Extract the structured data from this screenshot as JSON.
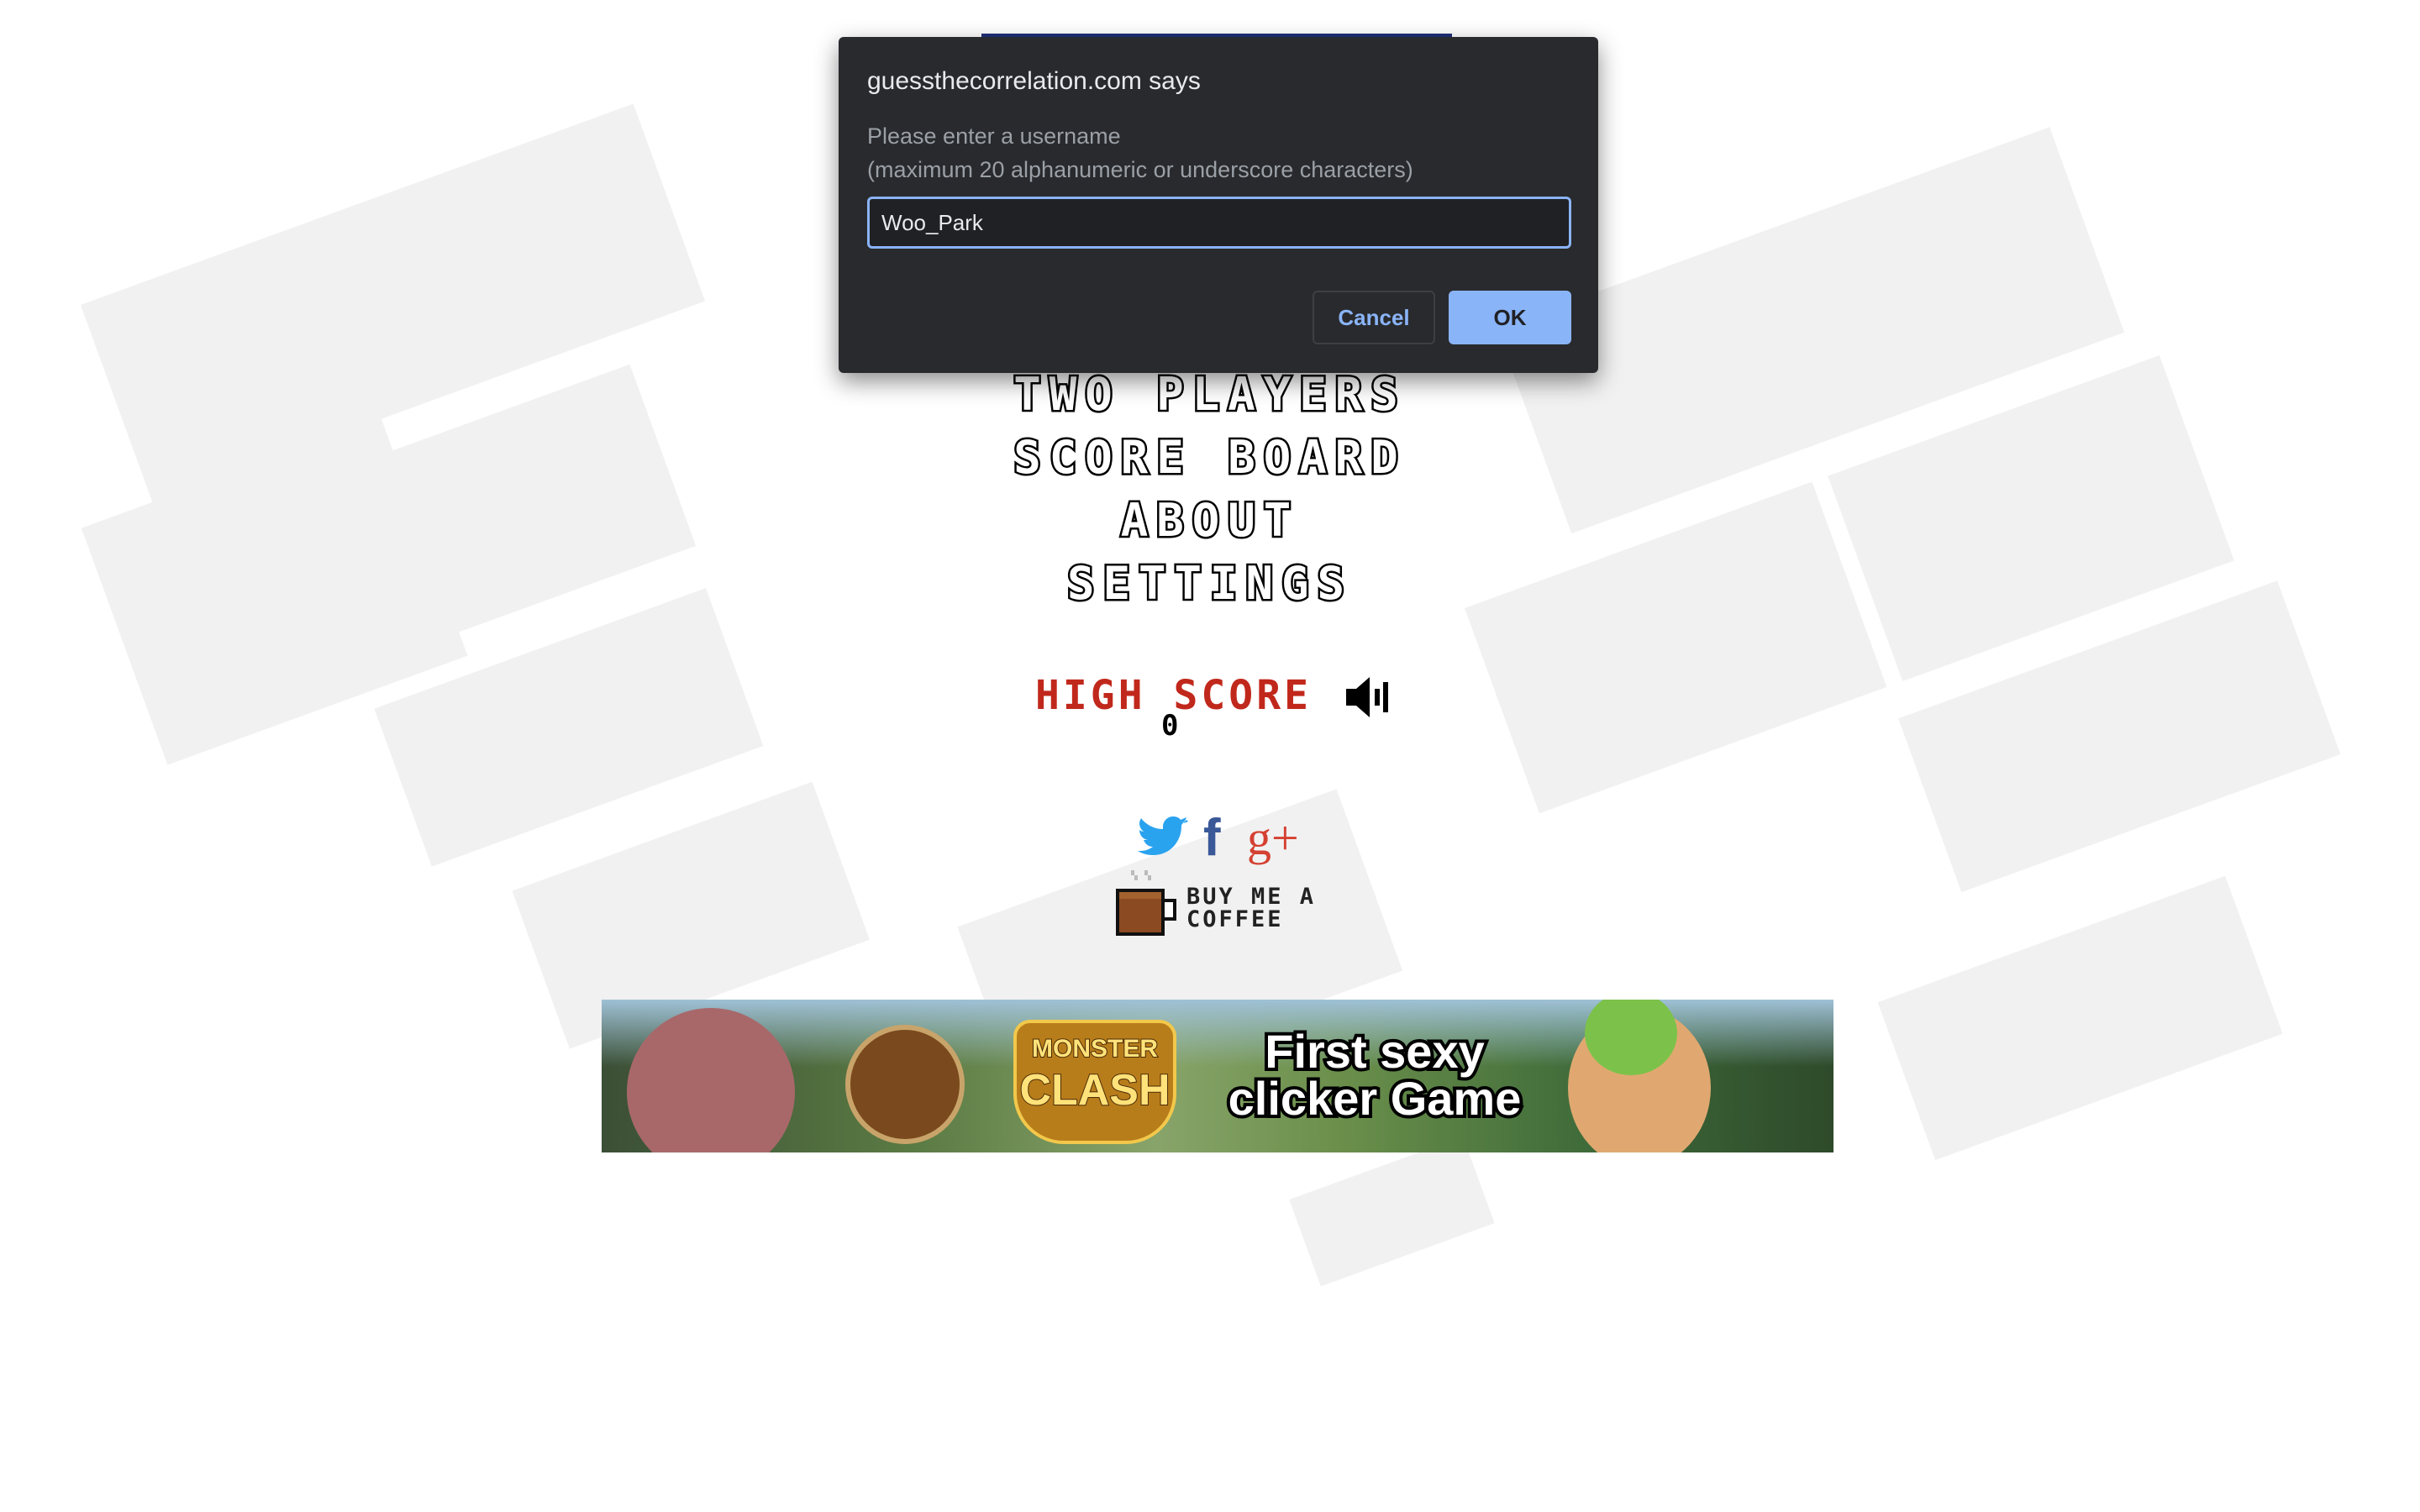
{
  "dialog": {
    "title": "guessthecorrelation.com says",
    "message_line1": "Please enter a username",
    "message_line2": "(maximum 20 alphanumeric or underscore characters)",
    "input_value": "Woo_Park",
    "cancel_label": "Cancel",
    "ok_label": "OK"
  },
  "menu": {
    "items": [
      {
        "label": "TWO PLAYERS"
      },
      {
        "label": "SCORE BOARD"
      },
      {
        "label": "ABOUT"
      },
      {
        "label": "SETTINGS"
      }
    ]
  },
  "high_score": {
    "label": "HIGH SCORE",
    "value": "0"
  },
  "social": {
    "twitter_icon": "twitter-icon",
    "facebook_icon": "facebook-icon",
    "googleplus_icon": "google-plus-icon",
    "googleplus_glyph": "g+",
    "facebook_glyph": "f"
  },
  "coffee": {
    "line1": "BUY ME A",
    "line2": "COFFEE"
  },
  "banner": {
    "logo_line1": "MONSTER",
    "logo_line2": "CLASH",
    "headline_line1": "First sexy",
    "headline_line2": "clicker Game"
  },
  "colors": {
    "dialog_bg": "#292a2d",
    "accent": "#8ab4f8",
    "high_score": "#c1281c"
  }
}
